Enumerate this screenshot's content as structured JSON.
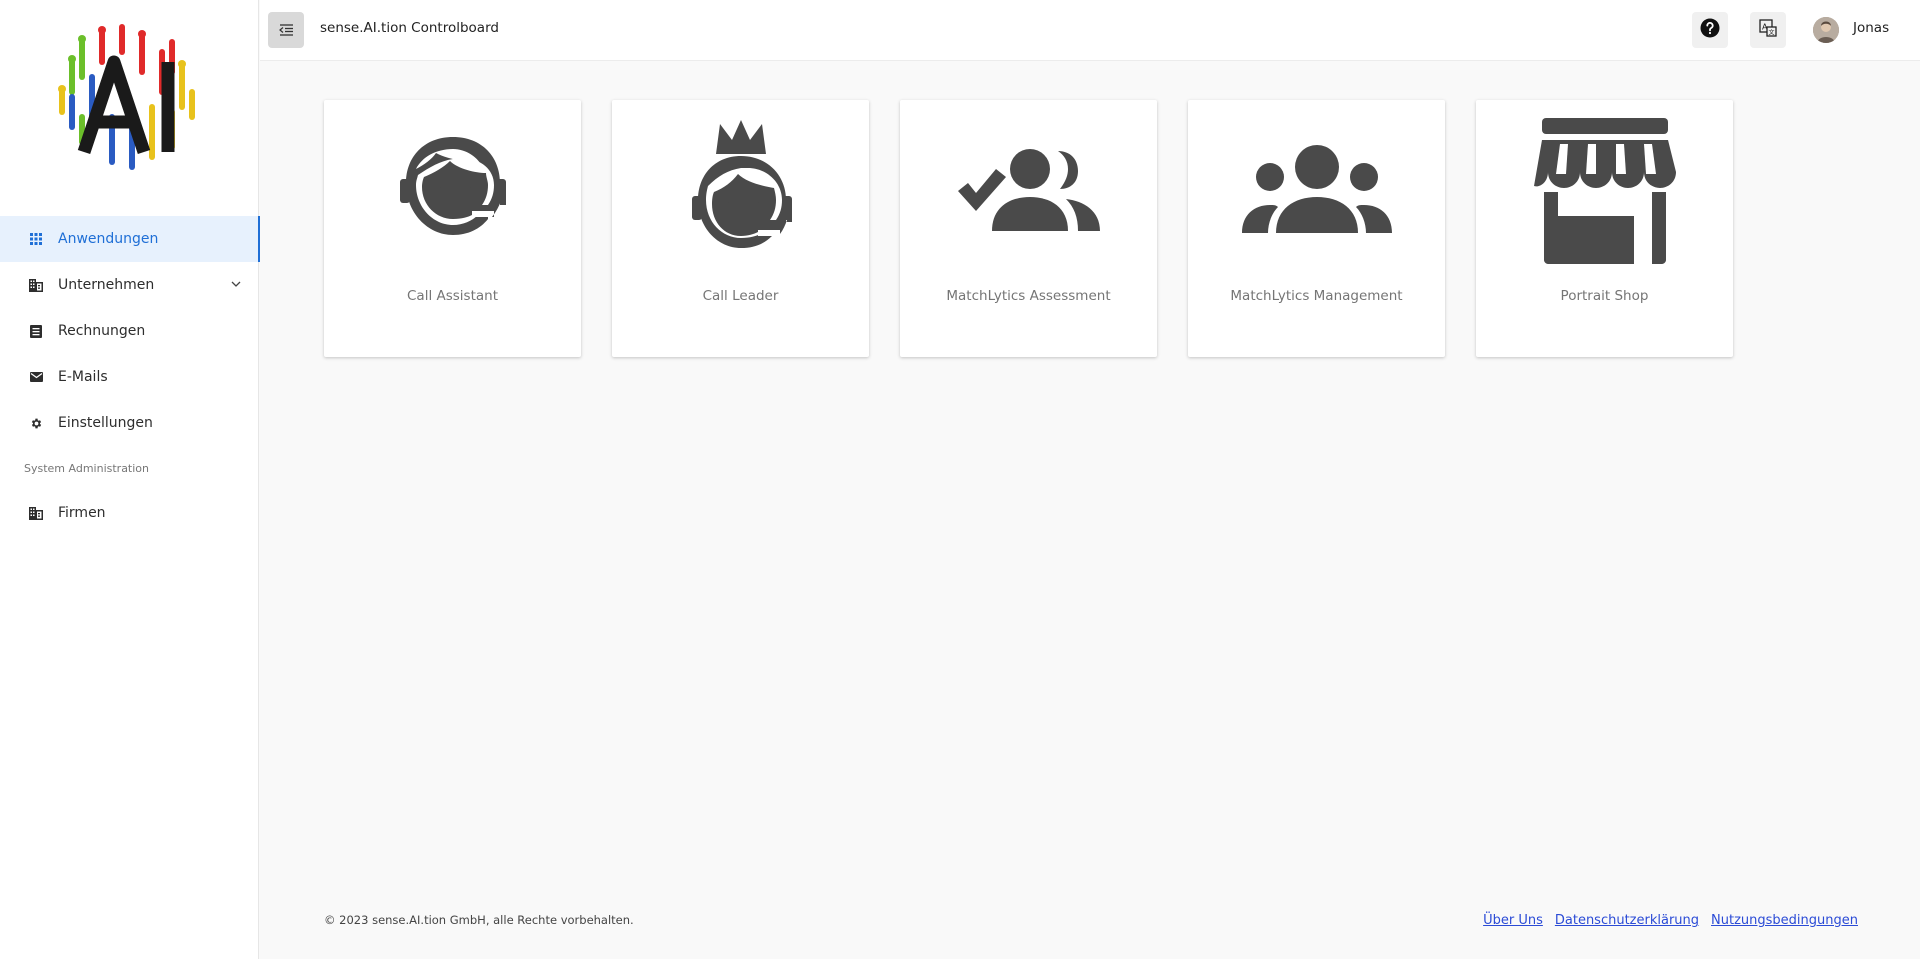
{
  "header": {
    "title": "sense.AI.tion Controlboard",
    "user_name": "Jonas"
  },
  "sidebar": {
    "logo_text": "AI",
    "items": [
      {
        "label": "Anwendungen",
        "icon": "grid-icon",
        "active": true
      },
      {
        "label": "Unternehmen",
        "icon": "building-icon",
        "expandable": true
      },
      {
        "label": "Rechnungen",
        "icon": "receipt-icon"
      },
      {
        "label": "E-Mails",
        "icon": "mail-icon"
      },
      {
        "label": "Einstellungen",
        "icon": "gear-icon"
      }
    ],
    "section_label": "System Administration",
    "admin_items": [
      {
        "label": "Firmen",
        "icon": "building-icon"
      }
    ]
  },
  "apps": [
    {
      "label": "Call Assistant",
      "icon": "headset-agent-icon"
    },
    {
      "label": "Call Leader",
      "icon": "crowned-agent-icon"
    },
    {
      "label": "MatchLytics Assessment",
      "icon": "group-check-icon"
    },
    {
      "label": "MatchLytics Management",
      "icon": "group-icon"
    },
    {
      "label": "Portrait Shop",
      "icon": "storefront-icon"
    }
  ],
  "footer": {
    "copyright": "© 2023 sense.AI.tion GmbH, alle Rechte vorbehalten.",
    "links": [
      "Über Uns",
      "Datenschutzerklärung",
      "Nutzungsbedingungen"
    ]
  },
  "colors": {
    "accent": "#1f6fd6",
    "active_bg": "#e7f1fd",
    "icon": "#4a4a4a",
    "link": "#2b4bd6"
  }
}
